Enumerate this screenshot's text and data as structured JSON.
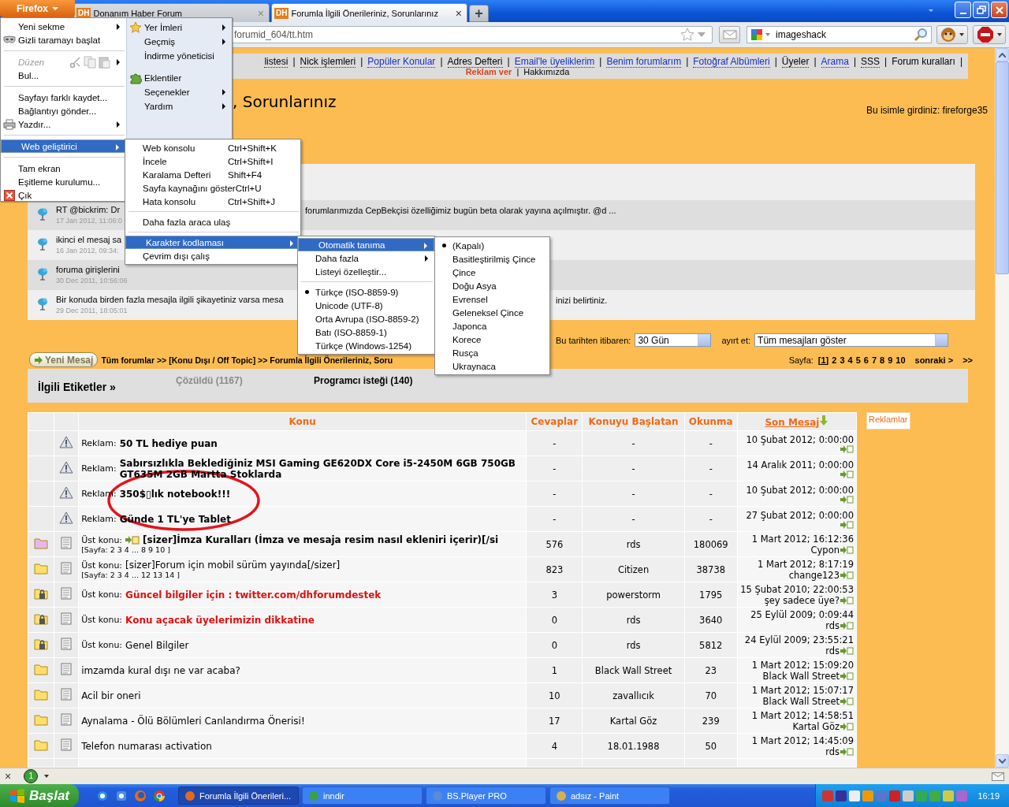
{
  "browser": {
    "firefox_button": "Firefox",
    "tabs": [
      {
        "favicon": "DH",
        "label": "Donanım Haber Forum",
        "close": "×",
        "selected": false
      },
      {
        "favicon": "DH",
        "label": "Forumla İlgili Önerileriniz, Sorunlarınız",
        "close": "×",
        "selected": true
      }
    ],
    "new_tab": "+",
    "url": "forumid_604/tt.htm",
    "search": "imageshack"
  },
  "app_menu": {
    "left": [
      {
        "kind": "item",
        "label": "Yeni sekme",
        "submenu": true,
        "selected": false,
        "disabled": false
      },
      {
        "kind": "item",
        "label": "Gizli taramayı başlat",
        "submenu": false,
        "selected": false,
        "disabled": false
      },
      {
        "kind": "separator"
      },
      {
        "kind": "item",
        "label": "Düzen",
        "submenu": true,
        "selected": false,
        "disabled": true
      },
      {
        "kind": "item",
        "label": "Bul...",
        "submenu": false,
        "selected": false,
        "disabled": false
      },
      {
        "kind": "separator"
      },
      {
        "kind": "item",
        "label": "Sayfayı farklı kaydet...",
        "submenu": false,
        "selected": false,
        "disabled": false
      },
      {
        "kind": "item",
        "label": "Bağlantıyı gönder...",
        "submenu": false,
        "selected": false,
        "disabled": false
      },
      {
        "kind": "item",
        "label": "Yazdır...",
        "submenu": true,
        "selected": false,
        "disabled": false
      },
      {
        "kind": "separator"
      },
      {
        "kind": "item",
        "label": "Web geliştirici",
        "submenu": true,
        "selected": true,
        "disabled": false
      },
      {
        "kind": "separator"
      },
      {
        "kind": "item",
        "label": "Tam ekran",
        "submenu": false,
        "selected": false,
        "disabled": false
      },
      {
        "kind": "item",
        "label": "Eşitleme kurulumu...",
        "submenu": false,
        "selected": false,
        "disabled": false
      },
      {
        "kind": "item",
        "label": "Çık",
        "submenu": false,
        "selected": false,
        "disabled": false
      }
    ],
    "right": [
      {
        "kind": "item",
        "label": "Yer İmleri",
        "submenu": true,
        "selected": false
      },
      {
        "kind": "item",
        "label": "Geçmiş",
        "submenu": true,
        "selected": false
      },
      {
        "kind": "item",
        "label": "İndirme yöneticisi",
        "submenu": false,
        "selected": false
      },
      {
        "kind": "spacer"
      },
      {
        "kind": "item",
        "label": "Eklentiler",
        "submenu": false,
        "selected": false
      },
      {
        "kind": "item",
        "label": "Seçenekler",
        "submenu": true,
        "selected": false
      },
      {
        "kind": "item",
        "label": "Yardım",
        "submenu": true,
        "selected": false
      }
    ]
  },
  "submenus": [
    {
      "items": [
        {
          "kind": "item",
          "label": "Web konsolu",
          "shortcut": "Ctrl+Shift+K",
          "submenu": false,
          "selected": false
        },
        {
          "kind": "item",
          "label": "İncele",
          "shortcut": "Ctrl+Shift+I",
          "submenu": false,
          "selected": false
        },
        {
          "kind": "item",
          "label": "Karalama Defteri",
          "shortcut": "Shift+F4",
          "submenu": false,
          "selected": false
        },
        {
          "kind": "item",
          "label": "Sayfa kaynağını göster",
          "shortcut": "Ctrl+U",
          "submenu": false,
          "selected": false
        },
        {
          "kind": "item",
          "label": "Hata konsolu",
          "shortcut": "Ctrl+Shift+J",
          "submenu": false,
          "selected": false
        },
        {
          "kind": "separator"
        },
        {
          "kind": "item",
          "label": "Daha fazla araca ulaş",
          "submenu": false,
          "selected": false
        },
        {
          "kind": "separator"
        },
        {
          "kind": "item",
          "label": "Karakter kodlaması",
          "submenu": true,
          "selected": true
        },
        {
          "kind": "item",
          "label": "Çevrim dışı çalış",
          "submenu": false,
          "selected": false
        }
      ]
    },
    {
      "items": [
        {
          "kind": "item",
          "label": "Otomatik tanıma",
          "submenu": true,
          "selected": true,
          "checked": false
        },
        {
          "kind": "item",
          "label": "Daha fazla",
          "submenu": true,
          "selected": false,
          "checked": false
        },
        {
          "kind": "item",
          "label": "Listeyi özelleştir...",
          "submenu": false,
          "selected": false,
          "checked": false
        },
        {
          "kind": "separator"
        },
        {
          "kind": "item",
          "label": "Türkçe (ISO-8859-9)",
          "submenu": false,
          "selected": false,
          "checked": true
        },
        {
          "kind": "item",
          "label": "Unicode (UTF-8)",
          "submenu": false,
          "selected": false,
          "checked": false
        },
        {
          "kind": "item",
          "label": "Orta Avrupa (ISO-8859-2)",
          "submenu": false,
          "selected": false,
          "checked": false
        },
        {
          "kind": "item",
          "label": "Batı (ISO-8859-1)",
          "submenu": false,
          "selected": false,
          "checked": false
        },
        {
          "kind": "item",
          "label": "Türkçe (Windows-1254)",
          "submenu": false,
          "selected": false,
          "checked": false
        }
      ]
    },
    {
      "items": [
        {
          "kind": "item",
          "label": "(Kapalı)",
          "submenu": false,
          "selected": false,
          "checked": true
        },
        {
          "kind": "item",
          "label": "Basitleştirilmiş Çince",
          "submenu": false,
          "selected": false,
          "checked": false
        },
        {
          "kind": "item",
          "label": "Çince",
          "submenu": false,
          "selected": false,
          "checked": false
        },
        {
          "kind": "item",
          "label": "Doğu Asya",
          "submenu": false,
          "selected": false,
          "checked": false
        },
        {
          "kind": "item",
          "label": "Evrensel",
          "submenu": false,
          "selected": false,
          "checked": false
        },
        {
          "kind": "item",
          "label": "Geleneksel Çince",
          "submenu": false,
          "selected": false,
          "checked": false
        },
        {
          "kind": "item",
          "label": "Japonca",
          "submenu": false,
          "selected": false,
          "checked": false
        },
        {
          "kind": "item",
          "label": "Korece",
          "submenu": false,
          "selected": false,
          "checked": false
        },
        {
          "kind": "item",
          "label": "Rusça",
          "submenu": false,
          "selected": false,
          "checked": false
        },
        {
          "kind": "item",
          "label": "Ukraynaca",
          "submenu": false,
          "selected": false,
          "checked": false
        }
      ]
    }
  ],
  "page": {
    "nav_line_1": [
      {
        "kind": "menu",
        "label": "listesi"
      },
      {
        "kind": "separator",
        "label": "|"
      },
      {
        "kind": "menu",
        "label": "Nick işlemleri"
      },
      {
        "kind": "separator",
        "label": "|"
      },
      {
        "kind": "link",
        "label": "Popüler Konular"
      },
      {
        "kind": "separator",
        "label": "|"
      },
      {
        "kind": "menu",
        "label": "Adres Defteri"
      },
      {
        "kind": "separator",
        "label": "|"
      },
      {
        "kind": "link",
        "label": "Email'le üyeliklerim"
      },
      {
        "kind": "separator",
        "label": "|"
      },
      {
        "kind": "link",
        "label": "Benim forumlarım"
      },
      {
        "kind": "separator",
        "label": "|"
      },
      {
        "kind": "link",
        "label": "Fotoğraf Albümleri"
      },
      {
        "kind": "separator",
        "label": "|"
      },
      {
        "kind": "menu",
        "label": "Üyeler"
      },
      {
        "kind": "separator",
        "label": "|"
      },
      {
        "kind": "link",
        "label": "Arama"
      },
      {
        "kind": "separator",
        "label": "|"
      },
      {
        "kind": "menu",
        "label": "SSS"
      },
      {
        "kind": "separator",
        "label": "|"
      },
      {
        "kind": "plain",
        "label": "Forum kuralları"
      },
      {
        "kind": "separator",
        "label": "|"
      }
    ],
    "nav_line_2": [
      {
        "kind": "ad",
        "label": "Reklam ver"
      },
      {
        "kind": "separator",
        "label": "|"
      },
      {
        "kind": "plain",
        "label": "Hakkımızda"
      }
    ],
    "title": ", Sorunlarınız",
    "user": "Bu isimle girdiniz: fireforge35",
    "tweets": [
      {
        "text": "RT @bickrim: Dr",
        "text_after": "forumlarımızda CepBekçisi özelliğimiz bugün beta olarak yayına açılmıştır. @d ...",
        "date": "17 Jan 2012, 11:06:0"
      },
      {
        "text": "ikinci el mesaj sa",
        "date": "16 Jan 2012, 09:34:"
      },
      {
        "text": "foruma girişlerini",
        "date": "30 Dec 2011, 10:56:06"
      },
      {
        "text": "Bir konuda birden fazla mesajla ilgili şikayetiniz varsa mesa",
        "text_after": "inizi belirtiniz.",
        "date": "29 Dec 2011, 18:05:01"
      }
    ],
    "since_label": "Bu tarihten itibaren:",
    "since_value": "30 Gün",
    "filter_label": "ayırt et:",
    "filter_value": "Tüm mesajları göster",
    "new_post": "Yeni Mesaj",
    "breadcrumb": "Tüm forumlar >> [Konu Dışı / Off Topic] >> Forumla İlgili Önerileriniz, Soru",
    "pages_label": "Sayfa:",
    "pages": [
      {
        "label": "[1]",
        "selected": true
      },
      {
        "label": "2",
        "selected": false
      },
      {
        "label": "3",
        "selected": false
      },
      {
        "label": "4",
        "selected": false
      },
      {
        "label": "5",
        "selected": false
      },
      {
        "label": "6",
        "selected": false
      },
      {
        "label": "7",
        "selected": false
      },
      {
        "label": "8",
        "selected": false
      },
      {
        "label": "9",
        "selected": false
      },
      {
        "label": "10",
        "selected": false
      }
    ],
    "next": "sonraki >",
    "last": ">>",
    "tags_title": "İlgili Etiketler »",
    "tags": [
      {
        "label": "Çözüldü (1167)",
        "color": "#8a8a8a"
      },
      {
        "label": "Programcı isteği (140)",
        "color": "#000000"
      }
    ],
    "ads_label": "Reklamlar"
  },
  "table": {
    "columns": [
      {
        "label": "Konu",
        "sorted": false
      },
      {
        "label": "Cevaplar",
        "sorted": false
      },
      {
        "label": "Konuyu Başlatan",
        "sorted": false
      },
      {
        "label": "Okunma",
        "sorted": false
      },
      {
        "label": "Son Mesaj",
        "sorted": true
      }
    ],
    "rows": [
      {
        "kind": "ad",
        "prefix": "Reklam:",
        "title": "50 TL hediye puan",
        "bold": true,
        "color": "#000000",
        "unread": false,
        "locked": false,
        "replies": "-",
        "starter": "-",
        "views": "-",
        "last_date": "10 Şubat 2012; 0:00:00"
      },
      {
        "kind": "ad",
        "prefix": "Reklam:",
        "title": "Sabırsızlıkla Beklediğiniz MSI Gaming GE620DX Core i5-2450M 6GB 750GB GT635M 2GB Martta Stoklarda",
        "bold": true,
        "color": "#000000",
        "unread": false,
        "locked": false,
        "replies": "-",
        "starter": "-",
        "views": "-",
        "last_date": "14 Aralık 2011; 0:00:00"
      },
      {
        "kind": "ad",
        "prefix": "Reklam:",
        "title": "350$▯lık notebook!!!",
        "bold": true,
        "color": "#000000",
        "unread": false,
        "locked": false,
        "replies": "-",
        "starter": "-",
        "views": "-",
        "last_date": "10 Şubat 2012; 0:00:00"
      },
      {
        "kind": "ad",
        "prefix": "Reklam:",
        "title": "Günde 1 TL'ye Tablet",
        "bold": true,
        "color": "#000000",
        "unread": false,
        "locked": false,
        "replies": "-",
        "starter": "-",
        "views": "-",
        "last_date": "27 Şubat 2012; 0:00:00"
      },
      {
        "kind": "sticky",
        "prefix": "Üst konu:",
        "title": "[sizer]İmza Kuralları (İmza ve mesaja resim nasıl ekleniri içerir)[/si",
        "pages": "[Sayfa: 2 3 4 ... 8 9 10 ]",
        "bold": true,
        "color": "#000000",
        "unread": true,
        "locked": false,
        "replies": "576",
        "starter": "rds",
        "views": "180069",
        "last_date": "1 Mart 2012; 16:12:36",
        "last_user": "Cypon"
      },
      {
        "kind": "sticky",
        "prefix": "Üst konu:",
        "title": "[sizer]Forum için mobil sürüm yayında[/sizer]",
        "pages": "[Sayfa: 2 3 4 ... 12 13 14 ]",
        "bold": false,
        "color": "#000000",
        "unread": false,
        "locked": false,
        "replies": "823",
        "starter": "Citizen",
        "views": "38738",
        "last_date": "1 Mart 2012; 8:17:19",
        "last_user": "change123"
      },
      {
        "kind": "sticky",
        "prefix": "Üst konu:",
        "title": "Güncel bilgiler için : twitter.com/dhforumdestek",
        "bold": true,
        "color": "#e01010",
        "unread": false,
        "locked": true,
        "replies": "3",
        "starter": "powerstorm",
        "views": "1795",
        "last_date": "15 Şubat 2010; 22:00:53",
        "last_user": "şey sadece üye?"
      },
      {
        "kind": "sticky",
        "prefix": "Üst konu:",
        "title": "Konu açacak üyelerimizin dikkatine",
        "bold": true,
        "color": "#e01010",
        "unread": false,
        "locked": true,
        "replies": "0",
        "starter": "rds",
        "views": "3640",
        "last_date": "25 Eylül 2009; 0:09:44",
        "last_user": "rds"
      },
      {
        "kind": "sticky",
        "prefix": "Üst konu:",
        "title": "Genel Bilgiler",
        "bold": false,
        "color": "#000000",
        "unread": false,
        "locked": true,
        "replies": "0",
        "starter": "rds",
        "views": "5812",
        "last_date": "24 Eylül 2009; 23:55:21",
        "last_user": "rds"
      },
      {
        "kind": "topic",
        "title": "imzamda kural dışı ne var acaba?",
        "bold": false,
        "color": "#000000",
        "unread": false,
        "locked": false,
        "replies": "1",
        "starter": "Black Wall Street",
        "views": "23",
        "last_date": "1 Mart 2012; 15:09:20",
        "last_user": "Black Wall Street"
      },
      {
        "kind": "topic",
        "title": "Acil bir oneri",
        "bold": false,
        "color": "#000000",
        "unread": false,
        "locked": false,
        "replies": "10",
        "starter": "zavallıcık",
        "views": "70",
        "last_date": "1 Mart 2012; 15:07:17",
        "last_user": "Black Wall Street"
      },
      {
        "kind": "topic",
        "title": "Aynalama - Ölü Bölümleri Canlandırma Önerisi!",
        "bold": false,
        "color": "#000000",
        "unread": false,
        "locked": false,
        "replies": "17",
        "starter": "Kartal Göz",
        "views": "239",
        "last_date": "1 Mart 2012; 14:58:51",
        "last_user": "Kartal Göz"
      },
      {
        "kind": "topic",
        "title": "Telefon numarası activation",
        "bold": false,
        "color": "#000000",
        "unread": false,
        "locked": false,
        "replies": "4",
        "starter": "18.01.1988",
        "views": "50",
        "last_date": "1 Mart 2012; 14:45:09",
        "last_user": "rds"
      }
    ]
  },
  "status_bar": {
    "close": "×",
    "badge": "1"
  },
  "taskbar": {
    "start": "Başlat",
    "tasks": [
      {
        "label": "Forumla İlgili Önerileri...",
        "selected": true
      },
      {
        "label": "inndir",
        "selected": false
      },
      {
        "label": "BS.Player PRO",
        "selected": false
      },
      {
        "label": "adsız - Paint",
        "selected": false
      }
    ],
    "clock": "16:19"
  }
}
